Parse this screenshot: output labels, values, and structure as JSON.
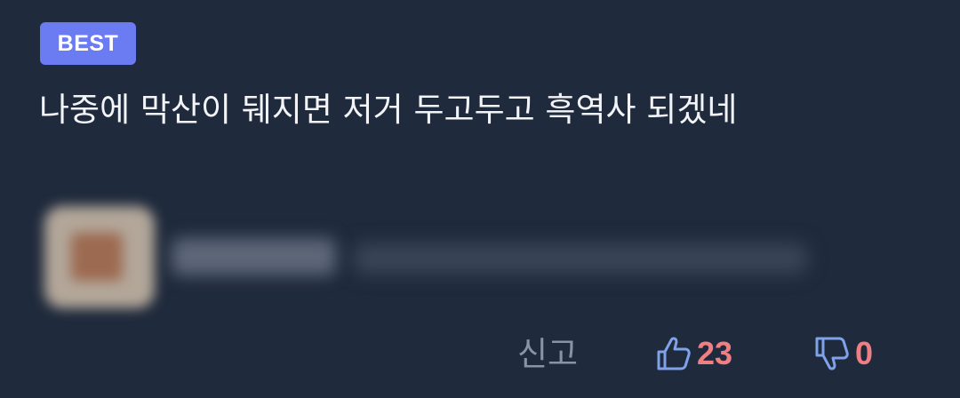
{
  "comment": {
    "badge": "BEST",
    "text": "나중에 막산이 뒈지면 저거 두고두고 흑역사 되겠네"
  },
  "actions": {
    "report_label": "신고",
    "like_count": "23",
    "dislike_count": "0"
  },
  "icons": {
    "like": "thumbs-up-icon",
    "dislike": "thumbs-down-icon"
  },
  "colors": {
    "background": "#1f2a3c",
    "badge": "#6b7cf2",
    "text": "#f2f4f8",
    "muted": "#8a93a3",
    "vote_icon": "#7fa2e8",
    "vote_count": "#f07f83"
  }
}
